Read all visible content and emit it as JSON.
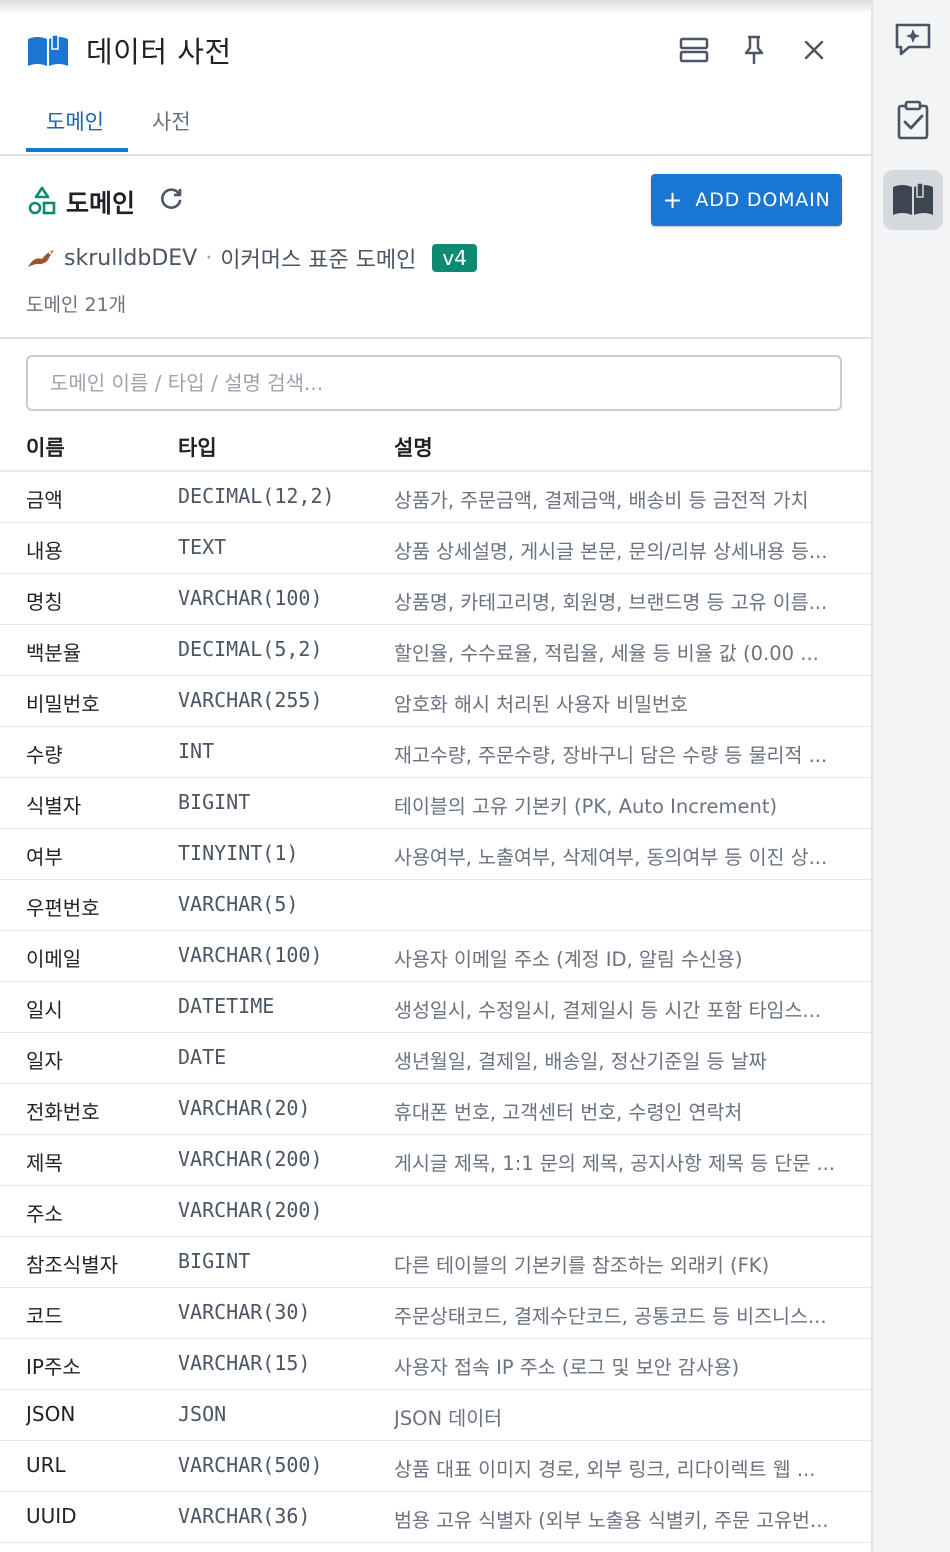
{
  "header": {
    "title": "데이터 사전",
    "icons": [
      "book-icon",
      "layout-icon",
      "pin-icon",
      "close-icon"
    ]
  },
  "tabs": [
    {
      "label": "도메인",
      "active": true
    },
    {
      "label": "사전",
      "active": false
    }
  ],
  "section": {
    "title": "도메인",
    "add_button": "ADD DOMAIN",
    "plus": "+"
  },
  "db": {
    "name": "skrulldbDEV",
    "separator": "·",
    "standard": "이커머스 표준 도메인",
    "version": "v4"
  },
  "count_text": "도메인 21개",
  "search": {
    "placeholder": "도메인 이름 / 타입 / 설명 검색..."
  },
  "table": {
    "columns": [
      "이름",
      "타입",
      "설명"
    ],
    "rows": [
      {
        "name": "금액",
        "type": "DECIMAL(12,2)",
        "desc": "상품가, 주문금액, 결제금액, 배송비 등 금전적 가치"
      },
      {
        "name": "내용",
        "type": "TEXT",
        "desc": "상품 상세설명, 게시글 본문, 문의/리뷰 상세내용 등..."
      },
      {
        "name": "명칭",
        "type": "VARCHAR(100)",
        "desc": "상품명, 카테고리명, 회원명, 브랜드명 등 고유 이름..."
      },
      {
        "name": "백분율",
        "type": "DECIMAL(5,2)",
        "desc": "할인율, 수수료율, 적립율, 세율 등 비율 값 (0.00 ..."
      },
      {
        "name": "비밀번호",
        "type": "VARCHAR(255)",
        "desc": "암호화 해시 처리된 사용자 비밀번호"
      },
      {
        "name": "수량",
        "type": "INT",
        "desc": "재고수량, 주문수량, 장바구니 담은 수량 등 물리적 ..."
      },
      {
        "name": "식별자",
        "type": "BIGINT",
        "desc": "테이블의 고유 기본키 (PK, Auto Increment)"
      },
      {
        "name": "여부",
        "type": "TINYINT(1)",
        "desc": "사용여부, 노출여부, 삭제여부, 동의여부 등 이진 상..."
      },
      {
        "name": "우편번호",
        "type": "VARCHAR(5)",
        "desc": ""
      },
      {
        "name": "이메일",
        "type": "VARCHAR(100)",
        "desc": "사용자 이메일 주소 (계정 ID, 알림 수신용)"
      },
      {
        "name": "일시",
        "type": "DATETIME",
        "desc": "생성일시, 수정일시, 결제일시 등 시간 포함 타임스..."
      },
      {
        "name": "일자",
        "type": "DATE",
        "desc": "생년월일, 결제일, 배송일, 정산기준일 등 날짜"
      },
      {
        "name": "전화번호",
        "type": "VARCHAR(20)",
        "desc": "휴대폰 번호, 고객센터 번호, 수령인 연락처"
      },
      {
        "name": "제목",
        "type": "VARCHAR(200)",
        "desc": "게시글 제목, 1:1 문의 제목, 공지사항 제목 등 단문 ..."
      },
      {
        "name": "주소",
        "type": "VARCHAR(200)",
        "desc": ""
      },
      {
        "name": "참조식별자",
        "type": "BIGINT",
        "desc": "다른 테이블의 기본키를 참조하는 외래키 (FK)"
      },
      {
        "name": "코드",
        "type": "VARCHAR(30)",
        "desc": "주문상태코드, 결제수단코드, 공통코드 등 비즈니스..."
      },
      {
        "name": "IP주소",
        "type": "VARCHAR(15)",
        "desc": "사용자 접속 IP 주소 (로그 및 보안 감사용)"
      },
      {
        "name": "JSON",
        "type": "JSON",
        "desc": "JSON 데이터"
      },
      {
        "name": "URL",
        "type": "VARCHAR(500)",
        "desc": "상품 대표 이미지 경로, 외부 링크, 리다이렉트 웹 ..."
      },
      {
        "name": "UUID",
        "type": "VARCHAR(36)",
        "desc": "범용 고유 식별자 (외부 노출용 식별키, 주문 고유번..."
      }
    ]
  },
  "sidebar": {
    "items": [
      {
        "icon": "ai-chat-icon",
        "active": false
      },
      {
        "icon": "clipboard-check-icon",
        "active": false
      },
      {
        "icon": "book-icon",
        "active": true
      }
    ]
  },
  "colors": {
    "accent": "#1976d2",
    "badge": "#0e8a72",
    "domain_icon": "#0e8a72"
  }
}
